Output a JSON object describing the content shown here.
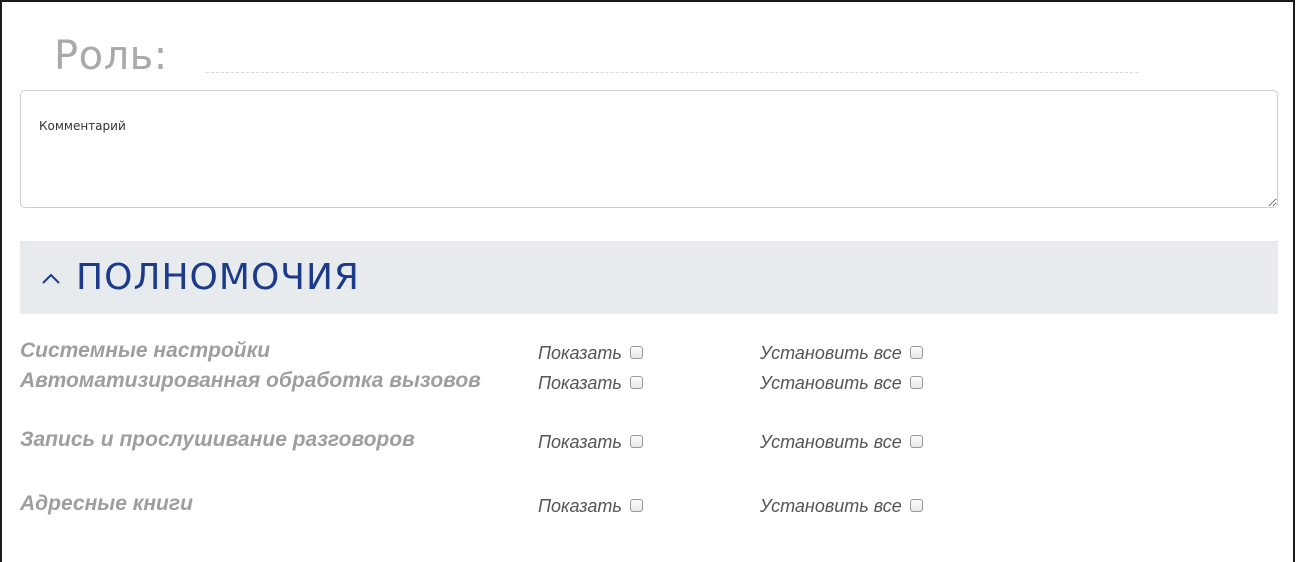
{
  "role": {
    "label": "Роль:",
    "value": ""
  },
  "comment": {
    "placeholder": "Комментарий",
    "value": ""
  },
  "permissions_section": {
    "title": "ПОЛНОМОЧИЯ",
    "expanded": true,
    "accent_color": "#1b3a8c",
    "header_bg": "#e7ebee",
    "icon": "chevron-up-icon"
  },
  "permissions": [
    {
      "name": "Системные настройки",
      "show_label": "Показать",
      "show_checked": false,
      "set_all_label": "Установить все",
      "set_all_checked": false
    },
    {
      "name": "Автоматизированная обработка вызовов",
      "show_label": "Показать",
      "show_checked": false,
      "set_all_label": "Установить все",
      "set_all_checked": false
    },
    {
      "name": "Запись и прослушивание разговоров",
      "show_label": "Показать",
      "show_checked": false,
      "set_all_label": "Установить все",
      "set_all_checked": false
    },
    {
      "name": "Адресные книги",
      "show_label": "Показать",
      "show_checked": false,
      "set_all_label": "Установить все",
      "set_all_checked": false
    }
  ]
}
